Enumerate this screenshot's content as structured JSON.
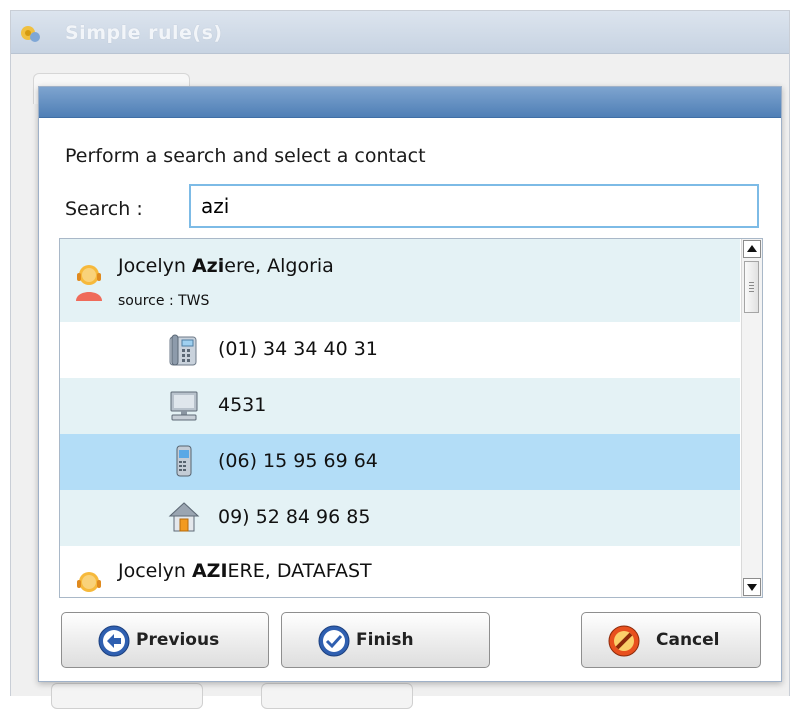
{
  "background_window": {
    "title": "Simple rule(s)"
  },
  "dialog": {
    "instruction": "Perform a search and select a contact",
    "search": {
      "label": "Search :",
      "value": "azi"
    },
    "results": [
      {
        "type": "contact",
        "name_before": "Jocelyn ",
        "name_match": "Azi",
        "name_after": "ere, Algoria",
        "source": "source : TWS",
        "icon": "person-icon"
      },
      {
        "type": "number",
        "icon": "desk-phone-icon",
        "value": "(01) 34 34 40 31",
        "selected": false
      },
      {
        "type": "number",
        "icon": "computer-icon",
        "value": "4531",
        "selected": false
      },
      {
        "type": "number",
        "icon": "mobile-phone-icon",
        "value": "(06) 15 95 69 64",
        "selected": true
      },
      {
        "type": "number",
        "icon": "home-icon",
        "value": "09) 52 84 96 85",
        "selected": false
      },
      {
        "type": "contact",
        "name_before": "Jocelyn ",
        "name_match": "AZI",
        "name_after": "ERE, DATAFAST",
        "icon": "person-icon"
      }
    ],
    "buttons": {
      "previous": "Previous",
      "finish": "Finish",
      "cancel": "Cancel"
    }
  },
  "colors": {
    "dialog_titlebar": "#5b89c0",
    "selected_row": "#b3ddf7",
    "alt_row": "#e4f2f5",
    "search_border": "#7dbbe6"
  }
}
